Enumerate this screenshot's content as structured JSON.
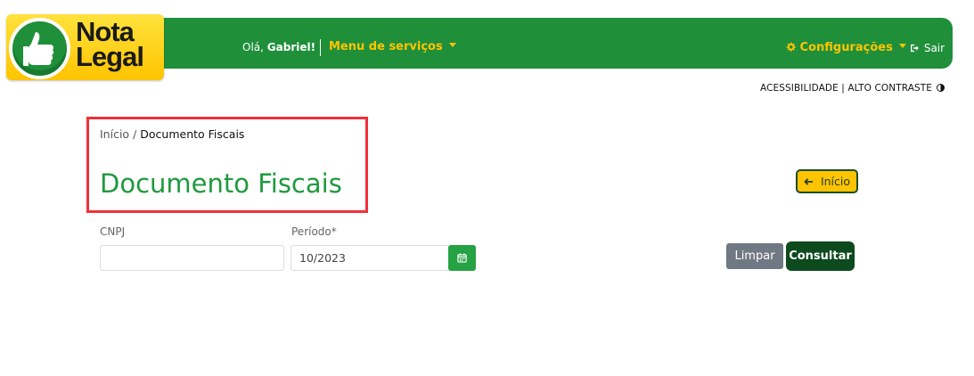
{
  "brand": {
    "logo_line1": "Nota",
    "logo_line2": "Legal"
  },
  "navbar": {
    "greeting_prefix": "Olá,",
    "user_name": "Gabriel!",
    "services_menu": "Menu de serviços",
    "settings_menu": "Configurações",
    "logout": "Sair"
  },
  "accessibility": {
    "text": "ACESSIBILIDADE | ALTO CONTRASTE"
  },
  "breadcrumb": {
    "home": "Início",
    "separator": "/",
    "current": "Documento Fiscais"
  },
  "page": {
    "title": "Documento Fiscais",
    "back_button": "Início"
  },
  "form": {
    "cnpj_label": "CNPJ",
    "cnpj_value": "",
    "period_label": "Período*",
    "period_value": "10/2023",
    "clear_button": "Limpar",
    "submit_button": "Consultar"
  },
  "colors": {
    "navbar_green": "#1f8f3a",
    "accent_yellow": "#ffc400",
    "title_green": "#1f9a3e",
    "highlight_red": "#f0303a",
    "dark_green": "#0d4a1e",
    "gray_button": "#707883"
  },
  "icons": [
    "thumbs-up-icon",
    "chevron-down-icon",
    "gear-icon",
    "sign-out-icon",
    "half-circle-contrast-icon",
    "arrow-left-icon",
    "calendar-icon"
  ]
}
